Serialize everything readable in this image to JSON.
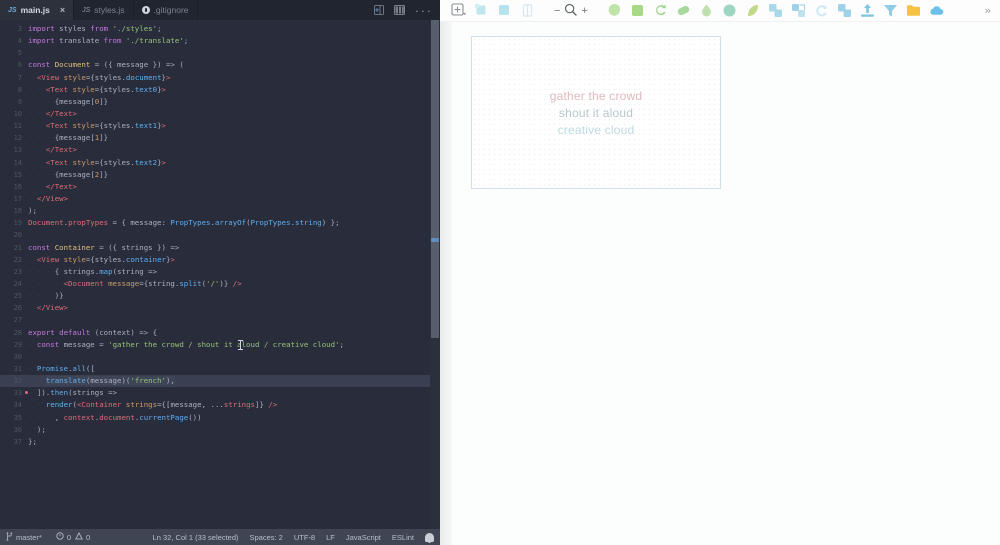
{
  "editor": {
    "tabs": [
      {
        "label": "main.js",
        "icon": "js-file-icon",
        "active": true,
        "closable": true
      },
      {
        "label": "styles.js",
        "icon": "js-file-icon",
        "active": false,
        "closable": false
      },
      {
        "label": ".gitignore",
        "icon": "git-file-icon",
        "active": false,
        "closable": false
      }
    ],
    "tab_actions": [
      {
        "name": "split-editor-icon",
        "label": "Split Editor"
      },
      {
        "name": "toggle-panel-icon",
        "label": "Toggle Panel Layout"
      },
      {
        "name": "more-actions-icon",
        "label": "..."
      }
    ],
    "close_glyph": "×",
    "first_line_number": 3,
    "lines": [
      {
        "n": 3,
        "tokens": [
          {
            "t": "import ",
            "c": "kw"
          },
          {
            "t": "styles",
            "c": "plain"
          },
          {
            "t": " from ",
            "c": "kw"
          },
          {
            "t": "'./styles'",
            "c": "str"
          },
          {
            "t": ";",
            "c": "pun"
          }
        ]
      },
      {
        "n": 4,
        "tokens": [
          {
            "t": "import ",
            "c": "kw"
          },
          {
            "t": "translate",
            "c": "plain"
          },
          {
            "t": " from ",
            "c": "kw"
          },
          {
            "t": "'./translate'",
            "c": "str"
          },
          {
            "t": ";",
            "c": "pun"
          }
        ]
      },
      {
        "n": 5,
        "tokens": []
      },
      {
        "n": 6,
        "tokens": [
          {
            "t": "const ",
            "c": "kw"
          },
          {
            "t": "Document",
            "c": "var"
          },
          {
            "t": " = ({ ",
            "c": "pun"
          },
          {
            "t": "message",
            "c": "plain"
          },
          {
            "t": " }) => (",
            "c": "pun"
          }
        ]
      },
      {
        "n": 7,
        "tokens": [
          {
            "t": "· ",
            "c": "ind"
          },
          {
            "t": "<View",
            "c": "tag"
          },
          {
            "t": " style",
            "c": "attr"
          },
          {
            "t": "={",
            "c": "pun"
          },
          {
            "t": "styles",
            "c": "plain"
          },
          {
            "t": ".",
            "c": "pun"
          },
          {
            "t": "document",
            "c": "fn"
          },
          {
            "t": "}",
            "c": "pun"
          },
          {
            "t": ">",
            "c": "tag"
          }
        ]
      },
      {
        "n": 8,
        "tokens": [
          {
            "t": "· · ",
            "c": "ind"
          },
          {
            "t": "<Text",
            "c": "tag"
          },
          {
            "t": " style",
            "c": "attr"
          },
          {
            "t": "={",
            "c": "pun"
          },
          {
            "t": "styles",
            "c": "plain"
          },
          {
            "t": ".",
            "c": "pun"
          },
          {
            "t": "text0",
            "c": "fn"
          },
          {
            "t": "}",
            "c": "pun"
          },
          {
            "t": ">",
            "c": "tag"
          }
        ]
      },
      {
        "n": 9,
        "tokens": [
          {
            "t": "· · · ",
            "c": "ind"
          },
          {
            "t": "{",
            "c": "pun"
          },
          {
            "t": "message",
            "c": "plain"
          },
          {
            "t": "[",
            "c": "pun"
          },
          {
            "t": "0",
            "c": "attr"
          },
          {
            "t": "]}",
            "c": "pun"
          }
        ]
      },
      {
        "n": 10,
        "tokens": [
          {
            "t": "· · ",
            "c": "ind"
          },
          {
            "t": "</Text>",
            "c": "tag"
          }
        ]
      },
      {
        "n": 11,
        "tokens": [
          {
            "t": "· · ",
            "c": "ind"
          },
          {
            "t": "<Text",
            "c": "tag"
          },
          {
            "t": " style",
            "c": "attr"
          },
          {
            "t": "={",
            "c": "pun"
          },
          {
            "t": "styles",
            "c": "plain"
          },
          {
            "t": ".",
            "c": "pun"
          },
          {
            "t": "text1",
            "c": "fn"
          },
          {
            "t": "}",
            "c": "pun"
          },
          {
            "t": ">",
            "c": "tag"
          }
        ]
      },
      {
        "n": 12,
        "tokens": [
          {
            "t": "· · · ",
            "c": "ind"
          },
          {
            "t": "{",
            "c": "pun"
          },
          {
            "t": "message",
            "c": "plain"
          },
          {
            "t": "[",
            "c": "pun"
          },
          {
            "t": "1",
            "c": "attr"
          },
          {
            "t": "]}",
            "c": "pun"
          }
        ]
      },
      {
        "n": 13,
        "tokens": [
          {
            "t": "· · ",
            "c": "ind"
          },
          {
            "t": "</Text>",
            "c": "tag"
          }
        ]
      },
      {
        "n": 14,
        "tokens": [
          {
            "t": "· · ",
            "c": "ind"
          },
          {
            "t": "<Text",
            "c": "tag"
          },
          {
            "t": " style",
            "c": "attr"
          },
          {
            "t": "={",
            "c": "pun"
          },
          {
            "t": "styles",
            "c": "plain"
          },
          {
            "t": ".",
            "c": "pun"
          },
          {
            "t": "text2",
            "c": "fn"
          },
          {
            "t": "}",
            "c": "pun"
          },
          {
            "t": ">",
            "c": "tag"
          }
        ]
      },
      {
        "n": 15,
        "tokens": [
          {
            "t": "· · · ",
            "c": "ind"
          },
          {
            "t": "{",
            "c": "pun"
          },
          {
            "t": "message",
            "c": "plain"
          },
          {
            "t": "[",
            "c": "pun"
          },
          {
            "t": "2",
            "c": "attr"
          },
          {
            "t": "]}",
            "c": "pun"
          }
        ]
      },
      {
        "n": 16,
        "tokens": [
          {
            "t": "· · ",
            "c": "ind"
          },
          {
            "t": "</Text>",
            "c": "tag"
          }
        ]
      },
      {
        "n": 17,
        "tokens": [
          {
            "t": "· ",
            "c": "ind"
          },
          {
            "t": "</View>",
            "c": "tag"
          }
        ]
      },
      {
        "n": 18,
        "tokens": [
          {
            "t": ");",
            "c": "pun"
          }
        ]
      },
      {
        "n": 19,
        "tokens": [
          {
            "t": "Document",
            "c": "prop"
          },
          {
            "t": ".",
            "c": "pun"
          },
          {
            "t": "propTypes",
            "c": "prop"
          },
          {
            "t": " = { ",
            "c": "pun"
          },
          {
            "t": "message",
            "c": "plain"
          },
          {
            "t": ": ",
            "c": "pun"
          },
          {
            "t": "PropTypes",
            "c": "fn"
          },
          {
            "t": ".",
            "c": "pun"
          },
          {
            "t": "arrayOf",
            "c": "fn"
          },
          {
            "t": "(",
            "c": "pun"
          },
          {
            "t": "PropTypes",
            "c": "fn"
          },
          {
            "t": ".",
            "c": "pun"
          },
          {
            "t": "string",
            "c": "fn"
          },
          {
            "t": ") };",
            "c": "pun"
          }
        ]
      },
      {
        "n": 20,
        "tokens": []
      },
      {
        "n": 21,
        "tokens": [
          {
            "t": "const ",
            "c": "kw"
          },
          {
            "t": "Container",
            "c": "var"
          },
          {
            "t": " = ({ ",
            "c": "pun"
          },
          {
            "t": "strings",
            "c": "plain"
          },
          {
            "t": " }) =>",
            "c": "pun"
          }
        ]
      },
      {
        "n": 22,
        "tokens": [
          {
            "t": "· ",
            "c": "ind"
          },
          {
            "t": "<View",
            "c": "tag"
          },
          {
            "t": " style",
            "c": "attr"
          },
          {
            "t": "={",
            "c": "pun"
          },
          {
            "t": "styles",
            "c": "plain"
          },
          {
            "t": ".",
            "c": "pun"
          },
          {
            "t": "container",
            "c": "fn"
          },
          {
            "t": "}",
            "c": "pun"
          },
          {
            "t": ">",
            "c": "tag"
          }
        ]
      },
      {
        "n": 23,
        "tokens": [
          {
            "t": "· · · ",
            "c": "ind"
          },
          {
            "t": "{ ",
            "c": "pun"
          },
          {
            "t": "strings",
            "c": "plain"
          },
          {
            "t": ".",
            "c": "pun"
          },
          {
            "t": "map",
            "c": "fn"
          },
          {
            "t": "(",
            "c": "pun"
          },
          {
            "t": "string",
            "c": "plain"
          },
          {
            "t": " =>",
            "c": "pun"
          }
        ]
      },
      {
        "n": 24,
        "tokens": [
          {
            "t": "· · · · ",
            "c": "ind"
          },
          {
            "t": "<Document",
            "c": "tag"
          },
          {
            "t": " message",
            "c": "attr"
          },
          {
            "t": "={",
            "c": "pun"
          },
          {
            "t": "string",
            "c": "plain"
          },
          {
            "t": ".",
            "c": "pun"
          },
          {
            "t": "split",
            "c": "fn"
          },
          {
            "t": "(",
            "c": "pun"
          },
          {
            "t": "'/'",
            "c": "str"
          },
          {
            "t": ")} ",
            "c": "pun"
          },
          {
            "t": "/>",
            "c": "tag"
          }
        ]
      },
      {
        "n": 25,
        "tokens": [
          {
            "t": "· · · ",
            "c": "ind"
          },
          {
            "t": ")}",
            "c": "pun"
          }
        ]
      },
      {
        "n": 26,
        "tokens": [
          {
            "t": "· ",
            "c": "ind"
          },
          {
            "t": "</View>",
            "c": "tag"
          }
        ]
      },
      {
        "n": 27,
        "tokens": []
      },
      {
        "n": 28,
        "tokens": [
          {
            "t": "export default ",
            "c": "kw"
          },
          {
            "t": "(",
            "c": "pun"
          },
          {
            "t": "context",
            "c": "plain"
          },
          {
            "t": ") => {",
            "c": "pun"
          }
        ]
      },
      {
        "n": 29,
        "tokens": [
          {
            "t": "· ",
            "c": "ind"
          },
          {
            "t": "const ",
            "c": "kw"
          },
          {
            "t": "message",
            "c": "plain"
          },
          {
            "t": " = ",
            "c": "pun"
          },
          {
            "t": "'gather the crowd / shout it aloud / creative cloud'",
            "c": "str"
          },
          {
            "t": ";",
            "c": "pun"
          }
        ],
        "cursor_after_chars": 47
      },
      {
        "n": 30,
        "tokens": []
      },
      {
        "n": 31,
        "tokens": [
          {
            "t": "· ",
            "c": "ind"
          },
          {
            "t": "Promise",
            "c": "fn"
          },
          {
            "t": ".",
            "c": "pun"
          },
          {
            "t": "all",
            "c": "fn"
          },
          {
            "t": "([",
            "c": "pun"
          }
        ]
      },
      {
        "n": 32,
        "tokens": [
          {
            "t": "· · ",
            "c": "ind"
          },
          {
            "t": "translate",
            "c": "fn"
          },
          {
            "t": "(",
            "c": "pun"
          },
          {
            "t": "message",
            "c": "plain"
          },
          {
            "t": ")(",
            "c": "pun"
          },
          {
            "t": "'french'",
            "c": "str"
          },
          {
            "t": "),",
            "c": "pun"
          }
        ],
        "selected": true
      },
      {
        "n": 33,
        "tokens": [
          {
            "t": "· ",
            "c": "ind"
          },
          {
            "t": "]).",
            "c": "pun"
          },
          {
            "t": "then",
            "c": "fn"
          },
          {
            "t": "(",
            "c": "pun"
          },
          {
            "t": "strings",
            "c": "plain"
          },
          {
            "t": " =>",
            "c": "pun"
          }
        ],
        "gutter_mark": true
      },
      {
        "n": 34,
        "tokens": [
          {
            "t": "· · ",
            "c": "ind"
          },
          {
            "t": "render",
            "c": "fn"
          },
          {
            "t": "(",
            "c": "pun"
          },
          {
            "t": "<Container",
            "c": "tag"
          },
          {
            "t": " strings",
            "c": "attr"
          },
          {
            "t": "={[",
            "c": "pun"
          },
          {
            "t": "message",
            "c": "plain"
          },
          {
            "t": ", ...",
            "c": "pun"
          },
          {
            "t": "strings",
            "c": "prop"
          },
          {
            "t": "]} ",
            "c": "pun"
          },
          {
            "t": "/>",
            "c": "tag"
          }
        ]
      },
      {
        "n": 35,
        "tokens": [
          {
            "t": "· · · ",
            "c": "ind"
          },
          {
            "t": ", ",
            "c": "pun"
          },
          {
            "t": "context",
            "c": "prop"
          },
          {
            "t": ".",
            "c": "pun"
          },
          {
            "t": "document",
            "c": "prop"
          },
          {
            "t": ".",
            "c": "pun"
          },
          {
            "t": "currentPage",
            "c": "fn"
          },
          {
            "t": "())",
            "c": "pun"
          }
        ]
      },
      {
        "n": 36,
        "tokens": [
          {
            "t": "· ",
            "c": "ind"
          },
          {
            "t": ");",
            "c": "pun"
          }
        ]
      },
      {
        "n": 37,
        "tokens": [
          {
            "t": "};",
            "c": "pun"
          }
        ]
      }
    ],
    "statusbar": {
      "branch": "master*",
      "branch_icon": "git-branch-icon",
      "errors_icon": "error-circle-icon",
      "errors": "0",
      "warnings_icon": "warning-triangle-icon",
      "warnings": "0",
      "cursor_position": "Ln 32, Col 1 (33 selected)",
      "indentation": "Spaces: 2",
      "encoding": "UTF-8",
      "line_ending": "LF",
      "language": "JavaScript",
      "linter": "ESLint",
      "notifications_icon": "bell-icon"
    }
  },
  "design": {
    "toolbar": {
      "items": [
        {
          "name": "add-artboard-button",
          "label": "Add",
          "glyph": "plus-box-icon"
        },
        {
          "name": "select-tool-button",
          "label": "Select",
          "glyph": "select-icon"
        },
        {
          "name": "artboard-tool-button",
          "label": "Artboard",
          "glyph": "artboard-icon"
        },
        {
          "name": "symbol-tool-button",
          "label": "Symbol",
          "glyph": "symbol-icon"
        }
      ],
      "zoom_out_label": "−",
      "zoom_icon": "magnifier-icon",
      "zoom_in_label": "+",
      "right_tools": [
        {
          "name": "shape-tool-button",
          "glyph": "blob-icon",
          "color": "#bfe3a8"
        },
        {
          "name": "rect-tool-button",
          "glyph": "square-icon",
          "color": "#a9d987"
        },
        {
          "name": "rotate-tool-button",
          "glyph": "rotate-icon",
          "color": "#9cd28a"
        },
        {
          "name": "link-tool-button",
          "glyph": "pill-icon",
          "color": "#a8d99b"
        },
        {
          "name": "paint-tool-button",
          "glyph": "drop-icon",
          "color": "#bfe0b0"
        },
        {
          "name": "mask-tool-button",
          "glyph": "circle-icon",
          "color": "#9fd6c2"
        },
        {
          "name": "merge-tool-button",
          "glyph": "leaf-icon",
          "color": "#c0d98a"
        },
        {
          "name": "group-tool-button",
          "glyph": "group-icon",
          "color": "#a8d9e8"
        },
        {
          "name": "ungroup-tool-button",
          "glyph": "ungroup-icon",
          "color": "#9fd2e6"
        },
        {
          "name": "refresh-tool-button",
          "glyph": "cycle-icon",
          "color": "#cfe9f2"
        },
        {
          "name": "duplicate-tool-button",
          "glyph": "duplicate-icon",
          "color": "#9fd2e8"
        },
        {
          "name": "align-tool-button",
          "glyph": "align-icon",
          "color": "#7fc4e0"
        },
        {
          "name": "distribute-tool-button",
          "glyph": "funnel-icon",
          "color": "#8ecbe4"
        },
        {
          "name": "export-tool-button",
          "glyph": "folder-icon",
          "color": "#f5c242"
        },
        {
          "name": "cloud-sync-button",
          "glyph": "cloud-icon",
          "color": "#6cc0ea"
        }
      ],
      "overflow_label": "»"
    },
    "artboard": {
      "name": "preview-artboard",
      "lines": [
        {
          "text": "gather the crowd",
          "color": "#e0b9bd"
        },
        {
          "text": "shout it aloud",
          "color": "#b7c6cb"
        },
        {
          "text": "creative cloud",
          "color": "#bfd9e4"
        }
      ]
    }
  }
}
